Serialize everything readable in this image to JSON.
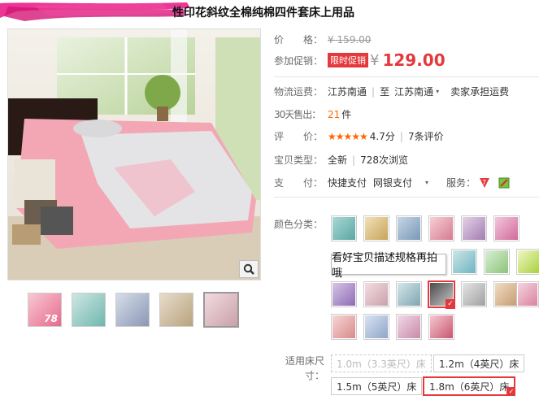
{
  "product": {
    "title": "性印花斜纹全棉纯棉四件套床上用品"
  },
  "info": {
    "price_label": "价　　格：",
    "original_price": "¥ 159.00",
    "promo_label": "参加促销：",
    "promo_badge": "限时促销",
    "promo_currency": "¥",
    "promo_price": "129.00",
    "shipping_label": "物流运费：",
    "shipping_from": "江苏南通",
    "shipping_to_prefix": "至",
    "shipping_to": "江苏南通",
    "shipping_note": "卖家承担运费",
    "sold_label": "30天售出：",
    "sold_count": "21",
    "sold_unit": "件",
    "rating_label": "评　　价：",
    "rating_stars": "★★★★★",
    "rating_score": "4.7分",
    "rating_reviews": "7条评价",
    "type_label": "宝贝类型：",
    "type_value": "全新",
    "views": "728次浏览",
    "pay_label": "支　　付：",
    "pay_methods": [
      "快捷支付",
      "网银支付"
    ],
    "service_label": "服务："
  },
  "color_label": "颜色分类：",
  "size_tip": "看好宝贝描述规格再拍哦",
  "size_label": "适用床尺寸：",
  "sizes": [
    {
      "label": "1.0m（3.3英尺）床",
      "state": "disabled"
    },
    {
      "label": "1.2m（4英尺）床",
      "state": "normal"
    },
    {
      "label": "1.5m（5英尺）床",
      "state": "normal"
    },
    {
      "label": "1.8m（6英尺）床",
      "state": "selected"
    }
  ],
  "thumb_badge": "78",
  "colors": {
    "accent": "#e4393c",
    "price": "#e4393c",
    "link": "#f60"
  }
}
